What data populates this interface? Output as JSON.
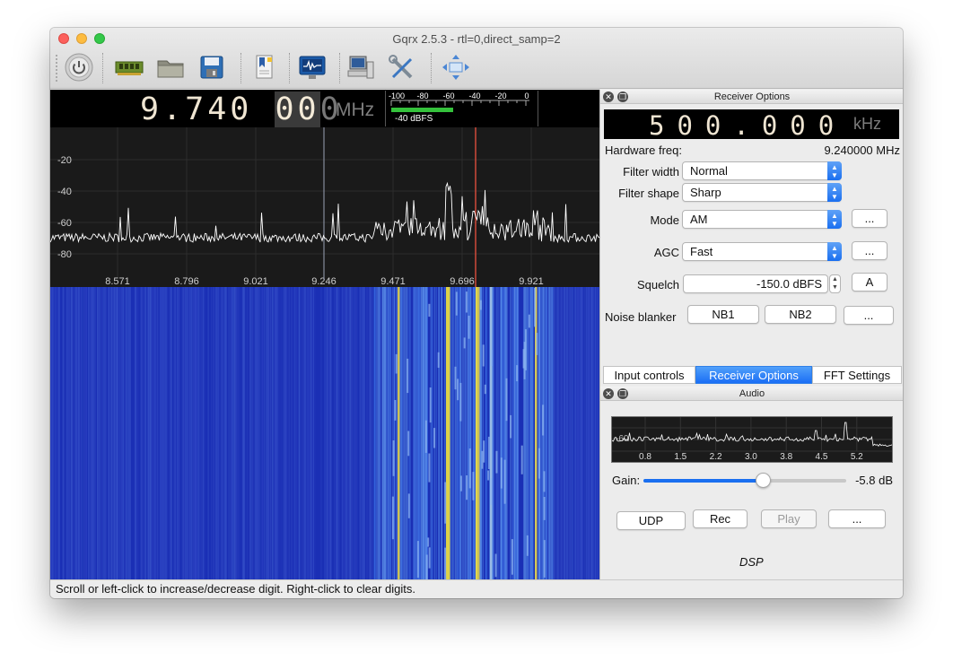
{
  "window": {
    "title": "Gqrx 2.5.3 - rtl=0,direct_samp=2"
  },
  "toolbar": {
    "items": [
      "power-icon",
      "hardware-device-icon",
      "open-folder-icon",
      "save-disk-icon",
      "bookmark-document-icon",
      "monitor-waveform-icon",
      "remote-network-icon",
      "tools-icon",
      "fullscreen-arrows-icon"
    ]
  },
  "frequency": {
    "digits_main": "9.740 ",
    "digits_sel": "00",
    "digits_last": "0",
    "unit": "MHz"
  },
  "signal_meter": {
    "scale": [
      "-100",
      "-80",
      "-60",
      "-40",
      "-20",
      "0"
    ],
    "level_text": "-40 dBFS",
    "level_fraction": 0.46
  },
  "spectrum": {
    "y_labels": [
      "-20",
      "-40",
      "-60",
      "-80"
    ],
    "x_labels": [
      "8.571",
      "8.796",
      "9.021",
      "9.246",
      "9.471",
      "9.696",
      "9.921"
    ]
  },
  "receiver_dock": {
    "title": "Receiver Options",
    "offset_digits": "500.000",
    "offset_unit": "kHz",
    "hw_freq_label": "Hardware freq:",
    "hw_freq_value": "9.240000 MHz",
    "filter_width_label": "Filter width",
    "filter_width_value": "Normal",
    "filter_shape_label": "Filter shape",
    "filter_shape_value": "Sharp",
    "mode_label": "Mode",
    "mode_value": "AM",
    "agc_label": "AGC",
    "agc_value": "Fast",
    "squelch_label": "Squelch",
    "squelch_value": "-150.0 dBFS",
    "squelch_auto": "A",
    "nb_label": "Noise blanker",
    "nb1": "NB1",
    "nb2": "NB2",
    "more": "..."
  },
  "tabs": [
    {
      "label": "Input controls",
      "selected": false
    },
    {
      "label": "Receiver Options",
      "selected": true
    },
    {
      "label": "FFT Settings",
      "selected": false
    }
  ],
  "audio_dock": {
    "title": "Audio",
    "spectrum_y": "-60",
    "x_labels": [
      "0.8",
      "1.5",
      "2.2",
      "3.0",
      "3.8",
      "4.5",
      "5.2"
    ],
    "gain_label": "Gain:",
    "gain_value": "-5.8 dB",
    "gain_fraction": 0.59,
    "udp": "UDP",
    "rec": "Rec",
    "play": "Play",
    "more": "...",
    "dsp": "DSP"
  },
  "status": "Scroll or left-click to increase/decrease digit. Right-click to clear digits.",
  "colors": {
    "accent": "#1a6ff0",
    "waterfall": "#1a2fb5",
    "trace": "#ffffff"
  }
}
